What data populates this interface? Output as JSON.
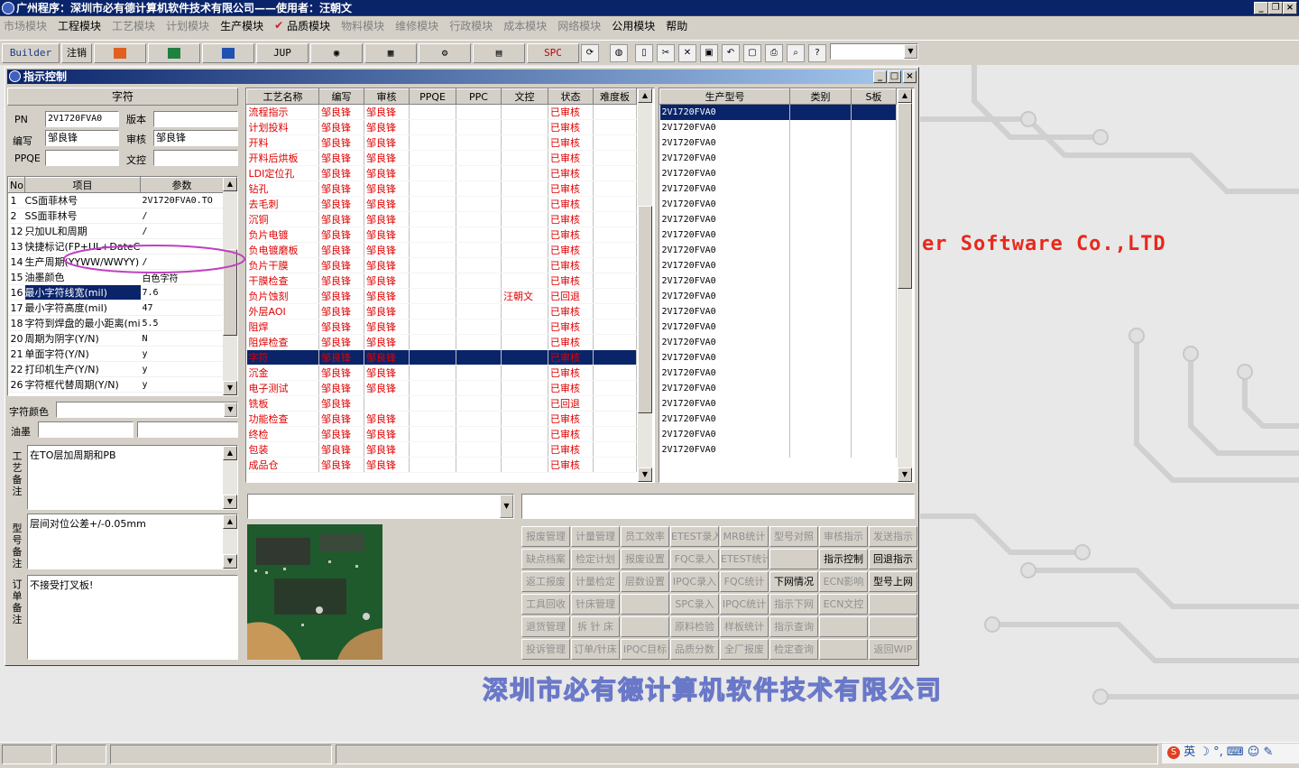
{
  "window": {
    "title": "广州程序：深圳市必有德计算机软件技术有限公司——使用者：汪朝文"
  },
  "menu": [
    "市场模块",
    "工程模块",
    "工艺模块",
    "计划模块",
    "生产模块",
    "品质模块",
    "物料模块",
    "维修模块",
    "行政模块",
    "成本模块",
    "网络模块",
    "公用模块",
    "帮助"
  ],
  "toolbar": {
    "builder": "Builder",
    "logout": "注销",
    "jup": "JUP",
    "spc": "SPC"
  },
  "child": {
    "title": "指示控制"
  },
  "header": {
    "section": "字符",
    "pn_label": "PN",
    "pn": "2V1720FVA0",
    "version_label": "版本",
    "version": "",
    "author_label": "编写",
    "author": "邹良锋",
    "review_label": "审核",
    "review": "邹良锋",
    "ppqe_label": "PPQE",
    "ppqe": "",
    "doc_label": "文控",
    "doc": ""
  },
  "params": {
    "col_no": "No",
    "col_item": "项目",
    "col_value": "参数",
    "rows": [
      {
        "no": "1",
        "item": "CS面菲林号",
        "val": "2V1720FVA0.TO"
      },
      {
        "no": "2",
        "item": "SS面菲林号",
        "val": "/"
      },
      {
        "no": "12",
        "item": "只加UL和周期",
        "val": "/"
      },
      {
        "no": "13",
        "item": "快捷标记(FP+UL+DateCode)",
        "val": ""
      },
      {
        "no": "14",
        "item": "生产周期(YYWW/WWYY)",
        "val": "/"
      },
      {
        "no": "15",
        "item": "油墨颜色",
        "val": "白色字符"
      },
      {
        "no": "16",
        "item": "最小字符线宽(mil)",
        "val": "7.6"
      },
      {
        "no": "17",
        "item": "最小字符高度(mil)",
        "val": "47"
      },
      {
        "no": "18",
        "item": "字符到焊盘的最小距离(mil)",
        "val": "5.5"
      },
      {
        "no": "20",
        "item": "周期为阴字(Y/N)",
        "val": "N"
      },
      {
        "no": "21",
        "item": "单面字符(Y/N)",
        "val": "y"
      },
      {
        "no": "22",
        "item": "打印机生产(Y/N)",
        "val": "y"
      },
      {
        "no": "26",
        "item": "字符框代替周期(Y/N)",
        "val": "y"
      }
    ]
  },
  "extra": {
    "color_label": "字符颜色",
    "color": "",
    "ink_label": "油墨",
    "ink": ""
  },
  "notes": {
    "process_label": "工艺备注",
    "process": "在TO层加周期和PB",
    "model_label": "型号备注",
    "model": "层间对位公差+/-0.05mm",
    "order_label": "订单备注",
    "order": "不接受打叉板!"
  },
  "process": {
    "cols": [
      "工艺名称",
      "编写",
      "审核",
      "PPQE",
      "PPC",
      "文控",
      "状态",
      "难度板"
    ],
    "rows": [
      [
        "流程指示",
        "邹良锋",
        "邹良锋",
        "",
        "",
        "",
        "已审核",
        ""
      ],
      [
        "计划投料",
        "邹良锋",
        "邹良锋",
        "",
        "",
        "",
        "已审核",
        ""
      ],
      [
        "开料",
        "邹良锋",
        "邹良锋",
        "",
        "",
        "",
        "已审核",
        ""
      ],
      [
        "开料后烘板",
        "邹良锋",
        "邹良锋",
        "",
        "",
        "",
        "已审核",
        ""
      ],
      [
        "LDI定位孔",
        "邹良锋",
        "邹良锋",
        "",
        "",
        "",
        "已审核",
        ""
      ],
      [
        "钻孔",
        "邹良锋",
        "邹良锋",
        "",
        "",
        "",
        "已审核",
        ""
      ],
      [
        "去毛刺",
        "邹良锋",
        "邹良锋",
        "",
        "",
        "",
        "已审核",
        ""
      ],
      [
        "沉铜",
        "邹良锋",
        "邹良锋",
        "",
        "",
        "",
        "已审核",
        ""
      ],
      [
        "负片电镀",
        "邹良锋",
        "邹良锋",
        "",
        "",
        "",
        "已审核",
        ""
      ],
      [
        "负电镀磨板",
        "邹良锋",
        "邹良锋",
        "",
        "",
        "",
        "已审核",
        ""
      ],
      [
        "负片干膜",
        "邹良锋",
        "邹良锋",
        "",
        "",
        "",
        "已审核",
        ""
      ],
      [
        "干膜检查",
        "邹良锋",
        "邹良锋",
        "",
        "",
        "",
        "已审核",
        ""
      ],
      [
        "负片蚀刻",
        "邹良锋",
        "邹良锋",
        "",
        "",
        "汪朝文",
        "已回退",
        ""
      ],
      [
        "外层AOI",
        "邹良锋",
        "邹良锋",
        "",
        "",
        "",
        "已审核",
        ""
      ],
      [
        "阻焊",
        "邹良锋",
        "邹良锋",
        "",
        "",
        "",
        "已审核",
        ""
      ],
      [
        "阻焊检查",
        "邹良锋",
        "邹良锋",
        "",
        "",
        "",
        "已审核",
        ""
      ],
      [
        "字符",
        "邹良锋",
        "邹良锋",
        "",
        "",
        "",
        "已审核",
        ""
      ],
      [
        "沉金",
        "邹良锋",
        "邹良锋",
        "",
        "",
        "",
        "已审核",
        ""
      ],
      [
        "电子测试",
        "邹良锋",
        "邹良锋",
        "",
        "",
        "",
        "已审核",
        ""
      ],
      [
        "铣板",
        "邹良锋",
        "",
        "",
        "",
        "",
        "已回退",
        ""
      ],
      [
        "功能检查",
        "邹良锋",
        "邹良锋",
        "",
        "",
        "",
        "已审核",
        ""
      ],
      [
        "终检",
        "邹良锋",
        "邹良锋",
        "",
        "",
        "",
        "已审核",
        ""
      ],
      [
        "包装",
        "邹良锋",
        "邹良锋",
        "",
        "",
        "",
        "已审核",
        ""
      ],
      [
        "成品仓",
        "邹良锋",
        "邹良锋",
        "",
        "",
        "",
        "已审核",
        ""
      ]
    ]
  },
  "models": {
    "cols": [
      "生产型号",
      "类别",
      "S板"
    ],
    "rows": [
      "2V1720FVA0",
      "2V1720FVA0",
      "2V1720FVA0",
      "2V1720FVA0",
      "2V1720FVA0",
      "2V1720FVA0",
      "2V1720FVA0",
      "2V1720FVA0",
      "2V1720FVA0",
      "2V1720FVA0",
      "2V1720FVA0",
      "2V1720FVA0",
      "2V1720FVA0",
      "2V1720FVA0",
      "2V1720FVA0",
      "2V1720FVA0",
      "2V1720FVA0",
      "2V1720FVA0",
      "2V1720FVA0",
      "2V1720FVA0",
      "2V1720FVA0",
      "2V1720FVA0",
      "2V1720FVA0"
    ]
  },
  "actions": [
    [
      {
        "t": "报废管理",
        "on": false
      },
      {
        "t": "计量管理",
        "on": false
      },
      {
        "t": "员工效率",
        "on": false
      },
      {
        "t": "ETEST录入",
        "on": false
      },
      {
        "t": "MRB统计",
        "on": false
      },
      {
        "t": "型号对照",
        "on": false
      },
      {
        "t": "审核指示",
        "on": false
      },
      {
        "t": "发送指示",
        "on": false
      }
    ],
    [
      {
        "t": "缺点档案",
        "on": false
      },
      {
        "t": "检定计划",
        "on": false
      },
      {
        "t": "报废设置",
        "on": false
      },
      {
        "t": "FQC录入",
        "on": false
      },
      {
        "t": "ETEST统计",
        "on": false
      },
      {
        "t": "",
        "on": false
      },
      {
        "t": "指示控制",
        "on": true
      },
      {
        "t": "回退指示",
        "on": true
      }
    ],
    [
      {
        "t": "返工报废",
        "on": false
      },
      {
        "t": "计量检定",
        "on": false
      },
      {
        "t": "层数设置",
        "on": false
      },
      {
        "t": "IPQC录入",
        "on": false
      },
      {
        "t": "FQC统计",
        "on": false
      },
      {
        "t": "下网情况",
        "on": true
      },
      {
        "t": "ECN影响",
        "on": false
      },
      {
        "t": "型号上网",
        "on": true
      }
    ],
    [
      {
        "t": "工具回收",
        "on": false
      },
      {
        "t": "针床管理",
        "on": false
      },
      {
        "t": "",
        "on": false
      },
      {
        "t": "SPC录入",
        "on": false
      },
      {
        "t": "IPQC统计",
        "on": false
      },
      {
        "t": "指示下网",
        "on": false
      },
      {
        "t": "ECN文控",
        "on": false
      },
      {
        "t": "",
        "on": false
      }
    ],
    [
      {
        "t": "退货管理",
        "on": false
      },
      {
        "t": "拆 针 床",
        "on": false
      },
      {
        "t": "",
        "on": false
      },
      {
        "t": "原料检验",
        "on": false
      },
      {
        "t": "样板统计",
        "on": false
      },
      {
        "t": "指示查询",
        "on": false
      },
      {
        "t": "",
        "on": false
      },
      {
        "t": "",
        "on": false
      }
    ],
    [
      {
        "t": "投诉管理",
        "on": false
      },
      {
        "t": "订单/针床",
        "on": false
      },
      {
        "t": "IPQC目标",
        "on": false
      },
      {
        "t": "品质分数",
        "on": false
      },
      {
        "t": "全厂报废",
        "on": false
      },
      {
        "t": "检定查询",
        "on": false
      },
      {
        "t": "",
        "on": false
      },
      {
        "t": "返回WIP",
        "on": false
      }
    ]
  ],
  "background": {
    "en": "er Software Co.,LTD",
    "cn": "深圳市必有德计算机软件技术有限公司"
  },
  "ime": {
    "text": "英"
  }
}
